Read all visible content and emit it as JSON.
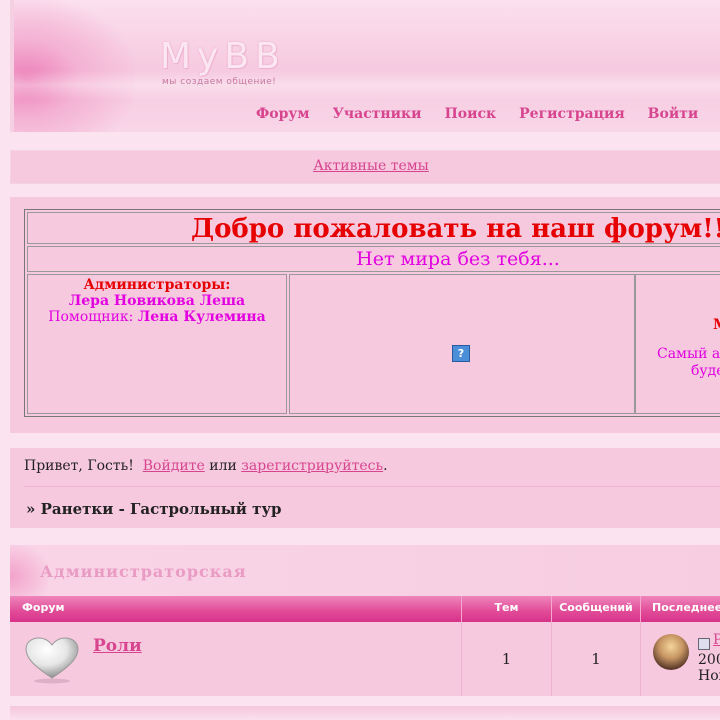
{
  "header": {
    "logo_title": "MyBB",
    "logo_tagline": "мы создаем общение!",
    "nav": [
      "Форум",
      "Участники",
      "Поиск",
      "Регистрация",
      "Войти"
    ]
  },
  "active_topics": "Активные темы",
  "welcome": {
    "title": "Добро пожаловать на наш форум!!",
    "subtitle": "Нет мира без тебя...",
    "admins_label": "Администраторы:",
    "admins_names": "Лера Новикова Леша",
    "helper_label": "Помощник:",
    "helper_name": "Лена Кулемина",
    "right_line1": "М",
    "right_line2": "Самый ан",
    "right_line3": "буде"
  },
  "greeting": {
    "prefix": "Привет, Гость!",
    "login": "Войдите",
    "or": "или",
    "register": "зарегистрируйтесь",
    "suffix": "."
  },
  "breadcrumb": "» Ранетки - Гастрольный тур",
  "category": {
    "title": "Администраторская",
    "columns": [
      "Форум",
      "Тем",
      "Сообщений",
      "Последнее"
    ],
    "forums": [
      {
        "name": "Роли",
        "topics": "1",
        "posts": "1",
        "last_post_link": "Р",
        "last_post_year": "200",
        "last_post_author": "Нон"
      }
    ]
  },
  "colors": {
    "accent": "#d8458f",
    "welcome_red": "#e60000",
    "welcome_magenta": "#e200e0",
    "panel_bg": "#f7c9df",
    "page_bg": "#fbe3f0"
  },
  "icons": {
    "help": "question-mark-icon",
    "forum": "heart-icon",
    "post": "post-icon"
  }
}
